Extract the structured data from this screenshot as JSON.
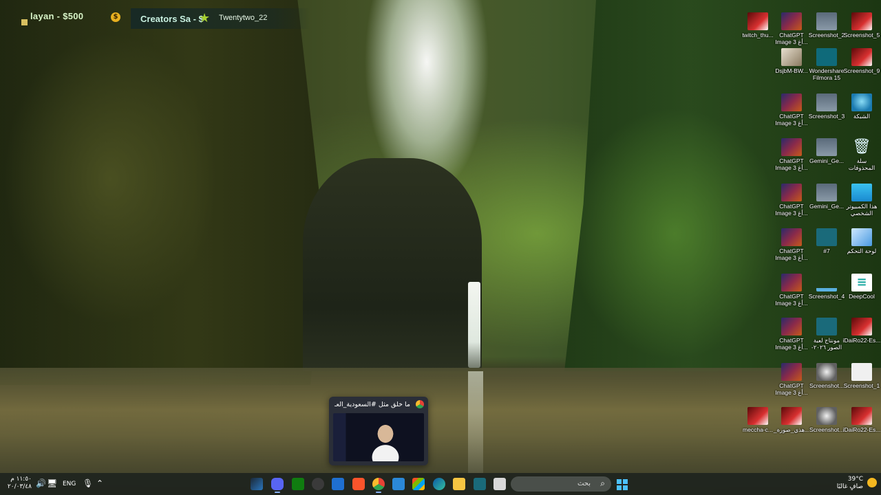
{
  "overlay": {
    "seg1": "layan - $500",
    "coin": "$",
    "seg2": "Creators Sa - $",
    "star": "★",
    "seg3": "Twentytwo_22"
  },
  "desktop_icons": [
    {
      "label": "twitch_thu...",
      "name": "twitch-thumbnail-icon"
    },
    {
      "label": "ChatGPT\nImage 3 أغ...",
      "name": "chatgpt-image-icon"
    },
    {
      "label": "Screenshot_2",
      "name": "screenshot-2-icon"
    },
    {
      "label": "Screenshot_5",
      "name": "screenshot-5-icon"
    },
    {
      "label": "DsjbM-BW...",
      "name": "dsjbm-icon"
    },
    {
      "label": "Wondershare\nFilmora 15",
      "name": "filmora-icon"
    },
    {
      "label": "Screenshot_9",
      "name": "screenshot-9-icon"
    },
    {
      "label": "ChatGPT\nImage 3 أغ...",
      "name": "chatgpt-image-icon"
    },
    {
      "label": "Screenshot_3",
      "name": "screenshot-3-icon"
    },
    {
      "label": "الشبكة",
      "name": "network-icon"
    },
    {
      "label": "ChatGPT\nImage 3 أغ...",
      "name": "chatgpt-image-icon"
    },
    {
      "label": "Gemini_Ge...",
      "name": "gemini-image-icon"
    },
    {
      "label": "سلة\nالمحذوفات",
      "name": "recycle-bin-icon"
    },
    {
      "label": "ChatGPT\nImage 3 أغ...",
      "name": "chatgpt-image-icon"
    },
    {
      "label": "Gemini_Ge...",
      "name": "gemini-image-icon"
    },
    {
      "label": "هذا الكمبيوتر\nالشخصي",
      "name": "this-pc-icon"
    },
    {
      "label": "ChatGPT\nImage 3 أغ...",
      "name": "chatgpt-image-icon"
    },
    {
      "label": "#7",
      "name": "folder-7-icon"
    },
    {
      "label": "لوحة التحكم",
      "name": "control-panel-icon"
    },
    {
      "label": "ChatGPT\nImage 3 أغ...",
      "name": "chatgpt-image-icon"
    },
    {
      "label": "Screenshot_4",
      "name": "screenshot-4-icon"
    },
    {
      "label": "DeepCool",
      "name": "deepcool-icon"
    },
    {
      "label": "ChatGPT\nImage 3 أغ...",
      "name": "chatgpt-image-icon"
    },
    {
      "label": "مونتاج لعبة\n-الصور ٢٠٢٦",
      "name": "montage-folder-icon"
    },
    {
      "label": "iDaiRo22-Es...",
      "name": "idairo-icon"
    },
    {
      "label": "ChatGPT\nImage 3 أغ...",
      "name": "chatgpt-image-icon"
    },
    {
      "label": "Screenshot...",
      "name": "screenshot-icon"
    },
    {
      "label": "Screenshot_1",
      "name": "screenshot-1-icon"
    },
    {
      "label": "meccha-c...",
      "name": "meccha-icon"
    },
    {
      "label": "_هذي_صورة...",
      "name": "image-file-icon"
    },
    {
      "label": "Screenshot...",
      "name": "screenshot-icon"
    },
    {
      "label": "iDaiRo22-Es...",
      "name": "idairo-icon"
    }
  ],
  "preview": {
    "title": "ما خلق مثل #السعودية_العـ..."
  },
  "taskbar": {
    "time": "١١:٥٠ م",
    "date": "٢٠/٠٣/٤٨",
    "lang": "ENG",
    "search_placeholder": "بحث",
    "temp": "39°C",
    "condition": "صافٍ غالبًا"
  }
}
